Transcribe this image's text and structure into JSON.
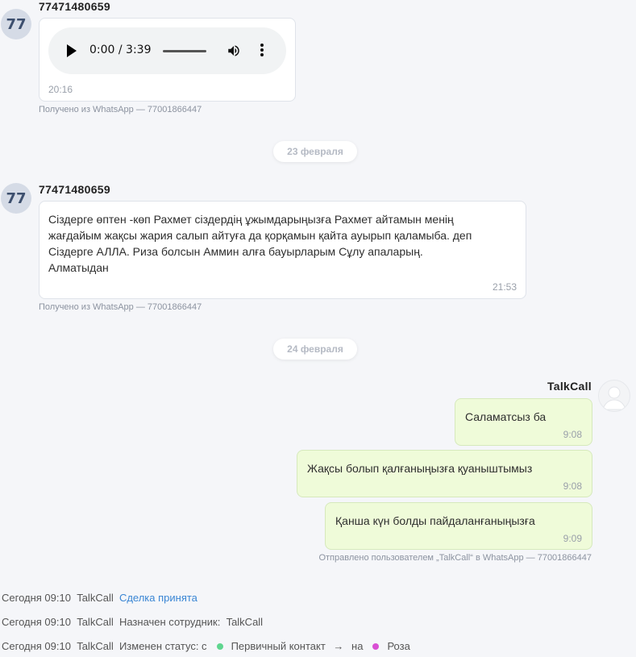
{
  "messages_in": [
    {
      "avatar": "77",
      "sender": "77471480659",
      "audio": {
        "time": "0:00 / 3:39"
      },
      "time": "20:16",
      "source": "Получено из WhatsApp — 77001866447"
    },
    {
      "avatar": "77",
      "sender": "77471480659",
      "lines": [
        "Сіздерге өптен -көп Рахмет сіздердің ұжымдарыңызға  Рахмет айтамын  менің",
        "жағдайым жақсы жария салып айтуға да  қорқамын қайта ауырып қаламыба. деп",
        "Сіздерге АЛЛА. Риза болсын Аммин алға бауырларым  Сұлу апаларың.",
        "Алматыдан"
      ],
      "time": "21:53",
      "source": "Получено из WhatsApp — 77001866447"
    }
  ],
  "dates": [
    "23 февраля",
    "24 февраля"
  ],
  "outgoing": {
    "sender": "TalkCall",
    "messages": [
      {
        "text": "Саламатсыз ба",
        "time": "9:08"
      },
      {
        "text": "Жақсы болып қалғаныңызға қуаныштымыз",
        "time": "9:08"
      },
      {
        "text": "Қанша күн болды пайдаланғаныңызға",
        "time": "9:09"
      }
    ],
    "source": "Отправлено пользователем „TalkCall“ в WhatsApp — 77001866447"
  },
  "log": [
    {
      "when": "Сегодня 09:10",
      "who": "TalkCall",
      "action": "Сделка принята"
    },
    {
      "when": "Сегодня 09:10",
      "who": "TalkCall",
      "action": "Назначен сотрудник:",
      "value": "TalkCall"
    },
    {
      "when": "Сегодня 09:10",
      "who": "TalkCall",
      "action": "Изменен статус: с",
      "from": "Первичный контакт",
      "arrow": "→",
      "to_word": "на",
      "to": "Роза"
    }
  ],
  "colors": {
    "status_from": "#5fd68f",
    "status_to": "#d94fd4",
    "link": "#3a86d4",
    "outgoing_bubble": "#effbd9"
  }
}
